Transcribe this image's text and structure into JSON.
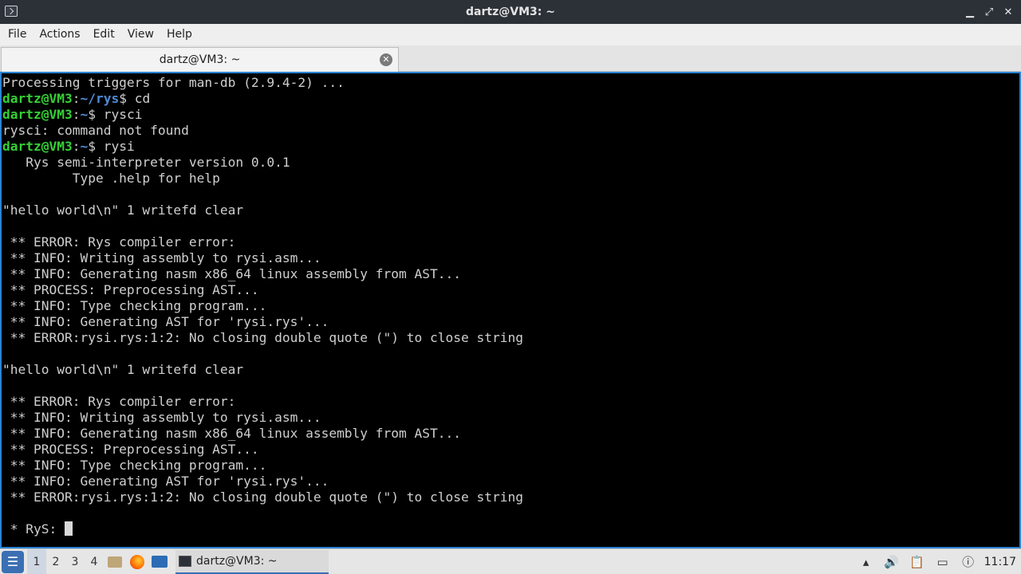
{
  "window": {
    "title": "dartz@VM3: ~",
    "controls": {
      "minimize": "▁",
      "maximize": "⤢",
      "close": "✕"
    }
  },
  "menubar": {
    "items": [
      {
        "label": "File"
      },
      {
        "label": "Actions"
      },
      {
        "label": "Edit"
      },
      {
        "label": "View"
      },
      {
        "label": "Help"
      }
    ]
  },
  "tabs": [
    {
      "label": "dartz@VM3: ~",
      "close_icon": "close-icon"
    }
  ],
  "terminal": {
    "lines": [
      {
        "text": "Processing triggers for man-db (2.9.4-2) ..."
      },
      {
        "user": "dartz@VM3",
        "path": "~/rys",
        "text": "$ cd"
      },
      {
        "user": "dartz@VM3",
        "path": "~",
        "text": "$ rysci"
      },
      {
        "text": "rysci: command not found"
      },
      {
        "user": "dartz@VM3",
        "path": "~",
        "text": "$ rysi"
      },
      {
        "text": "   Rys semi-interpreter version 0.0.1"
      },
      {
        "text": "         Type .help for help"
      },
      {
        "text": ""
      },
      {
        "text": "\"hello world\\n\" 1 writefd clear"
      },
      {
        "text": ""
      },
      {
        "text": " ** ERROR: Rys compiler error:"
      },
      {
        "text": " ** INFO: Writing assembly to rysi.asm..."
      },
      {
        "text": " ** INFO: Generating nasm x86_64 linux assembly from AST..."
      },
      {
        "text": " ** PROCESS: Preprocessing AST..."
      },
      {
        "text": " ** INFO: Type checking program..."
      },
      {
        "text": " ** INFO: Generating AST for 'rysi.rys'..."
      },
      {
        "text": " ** ERROR:rysi.rys:1:2: No closing double quote (\") to close string"
      },
      {
        "text": ""
      },
      {
        "text": "\"hello world\\n\" 1 writefd clear"
      },
      {
        "text": ""
      },
      {
        "text": " ** ERROR: Rys compiler error:"
      },
      {
        "text": " ** INFO: Writing assembly to rysi.asm..."
      },
      {
        "text": " ** INFO: Generating nasm x86_64 linux assembly from AST..."
      },
      {
        "text": " ** PROCESS: Preprocessing AST..."
      },
      {
        "text": " ** INFO: Type checking program..."
      },
      {
        "text": " ** INFO: Generating AST for 'rysi.rys'..."
      },
      {
        "text": " ** ERROR:rysi.rys:1:2: No closing double quote (\") to close string"
      },
      {
        "text": ""
      },
      {
        "text": " * RyS: ",
        "cursor": true
      }
    ]
  },
  "taskbar": {
    "workspaces": [
      "1",
      "2",
      "3",
      "4"
    ],
    "active_workspace": "1",
    "launchers": [
      "file-manager-icon",
      "firefox-icon",
      "show-desktop-icon"
    ],
    "task_label": "dartz@VM3: ~",
    "clock": "11:17"
  },
  "colors": {
    "prompt_user": "#35d035",
    "prompt_path": "#4e8bd6",
    "terminal_bg": "#000000",
    "terminal_border": "#2a83d6"
  }
}
